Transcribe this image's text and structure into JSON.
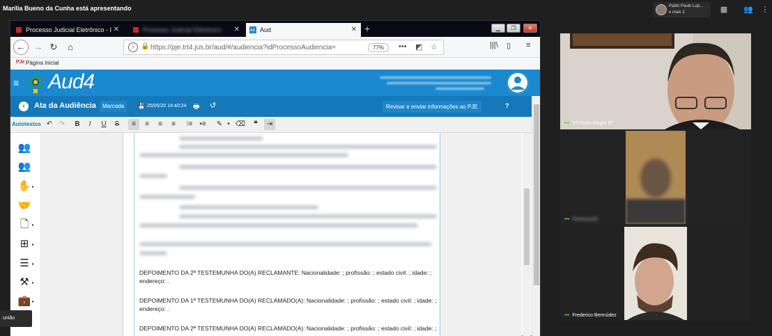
{
  "presenter": {
    "text": "Marília Bueno da Cunha está apresentando",
    "participants_name": "Pablo Paulo Lop...",
    "participants_more": "e mais 2"
  },
  "browser": {
    "tabs": [
      {
        "label": "Processo Judicial Eletrônico - I"
      },
      {
        "label": "Processo Judicial Eletrônico"
      },
      {
        "label": "Aud"
      }
    ],
    "url": "https://pje.trt4.jus.br/aud/#/audiencia?idProcessoAudiencia=",
    "zoom": "77%",
    "bookmark": "Página Inicial"
  },
  "app": {
    "logo": "Aud4",
    "page_title": "Ata da Audiência",
    "status": "Marcada",
    "saved_at": "25/05/20 14:40:24",
    "revisar_label": "Revisar e enviar informações ao PJE",
    "help": "?",
    "autotextos": "Autotextos"
  },
  "document": {
    "lines": [
      "DEPOIMENTO DA 2ª TESTEMUNHA DO(A) RECLAMANTE: Nacionalidade: ; profissão: ; estado civil: ; idade: ;",
      "endereço: .",
      "DEPOIMENTO DA 1ª TESTEMUNHA DO(A) RECLAMADO(A): Nacionalidade: ; profissão: ; estado civil: ; idade: ;",
      "endereço: .",
      "DEPOIMENTO DA 2ª TESTEMUNHA DO(A) RECLAMADO(A): Nacionalidade: ; profissão: ; estado civil: ; idade: ;"
    ]
  },
  "tooltip": "união",
  "videos": [
    {
      "label": "VT Porto Alegre 5ª"
    },
    {
      "label": "Participante"
    },
    {
      "label": "Frederico Bermúdez"
    }
  ],
  "colors": {
    "app_blue": "#1a89cf",
    "ata_bar": "#1578b9",
    "green_tool": "#2e9e3e",
    "orange_tool": "#f08a1c"
  }
}
